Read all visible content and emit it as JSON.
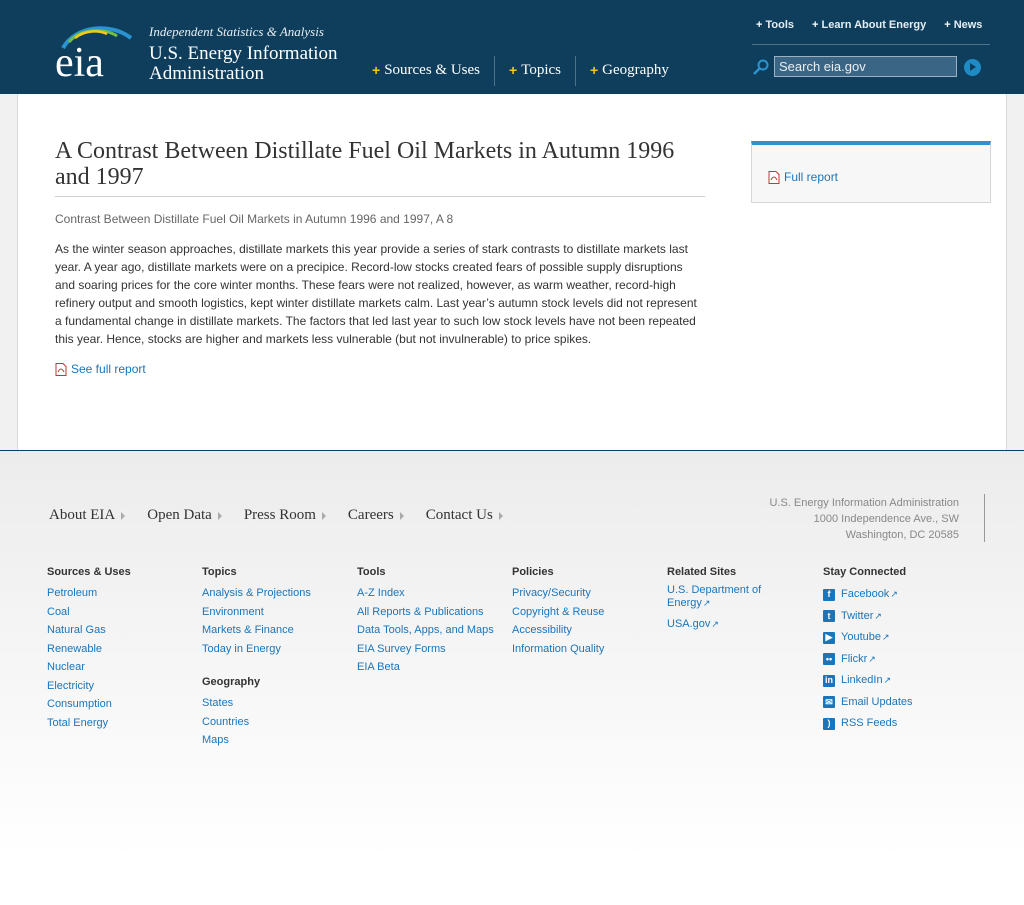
{
  "header": {
    "tagline": "Independent Statistics & Analysis",
    "org_line1": "U.S. Energy Information",
    "org_line2": "Administration",
    "logo_text": "eia",
    "main_nav": [
      "Sources & Uses",
      "Topics",
      "Geography"
    ],
    "top_links": [
      "Tools",
      "Learn About Energy",
      "News"
    ],
    "search_placeholder": "Search eia.gov"
  },
  "article": {
    "title": "A Contrast Between Distillate Fuel Oil Markets in Autumn 1996 and 1997",
    "subtitle": "Contrast Between Distillate Fuel Oil Markets in Autumn 1996 and 1997, A 8",
    "body": "As the winter season approaches, distillate markets this year provide a series of stark contrasts to distillate markets last year. A year ago, distillate markets were on a precipice. Record-low stocks created fears of possible supply disruptions and soaring prices for the core winter months. These fears were not realized, however, as warm weather, record-high refinery output and smooth logistics, kept winter distillate markets calm. Last year’s autumn stock levels did not represent a fundamental change in distillate markets. The factors that led last year to such low stock levels have not been repeated this year. Hence, stocks are higher and markets less vulnerable (but not invulnerable) to price spikes.",
    "see_full_report": "See full report"
  },
  "sidebar": {
    "full_report": "Full report"
  },
  "footer": {
    "nav": [
      "About EIA",
      "Open Data",
      "Press Room",
      "Careers",
      "Contact Us"
    ],
    "address": [
      "U.S. Energy Information Administration",
      "1000 Independence Ave., SW",
      "Washington, DC 20585"
    ],
    "columns": {
      "sources": {
        "heading": "Sources & Uses",
        "links": [
          "Petroleum",
          "Coal",
          "Natural Gas",
          "Renewable",
          "Nuclear",
          "Electricity",
          "Consumption",
          "Total Energy"
        ]
      },
      "topics": {
        "heading": "Topics",
        "links": [
          "Analysis & Projections",
          "Environment",
          "Markets & Finance",
          "Today in Energy"
        ]
      },
      "geography": {
        "heading": "Geography",
        "links": [
          "States",
          "Countries",
          "Maps"
        ]
      },
      "tools": {
        "heading": "Tools",
        "links": [
          "A-Z Index",
          "All Reports & Publications",
          "Data Tools, Apps, and Maps",
          "EIA Survey Forms",
          "EIA Beta"
        ]
      },
      "policies": {
        "heading": "Policies",
        "links": [
          "Privacy/Security",
          "Copyright & Reuse",
          "Accessibility",
          "Information Quality"
        ]
      },
      "related": {
        "heading": "Related Sites",
        "links": [
          "U.S. Department of Energy",
          "USA.gov"
        ]
      },
      "stay": {
        "heading": "Stay Connected",
        "links": [
          "Facebook",
          "Twitter",
          "Youtube",
          "Flickr",
          "LinkedIn",
          "Email Updates",
          "RSS Feeds"
        ]
      }
    }
  },
  "colors": {
    "header_bg": "#0e3e5c",
    "link": "#1b75bb",
    "accent": "#2a93d0",
    "plus": "#f5c91a"
  }
}
